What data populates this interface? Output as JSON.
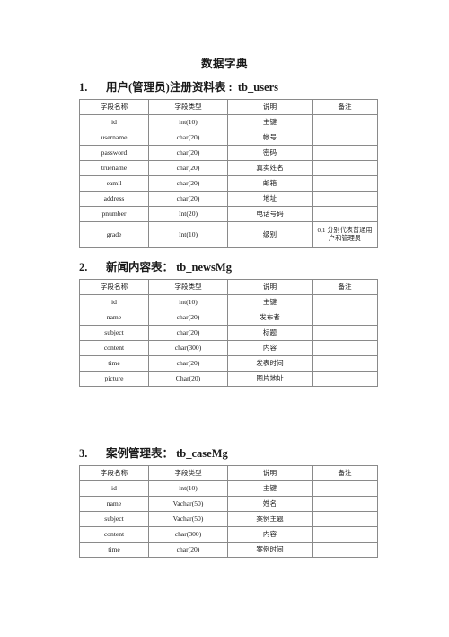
{
  "document": {
    "title": "数据字典",
    "column_headers": [
      "字段名称",
      "字段类型",
      "说明",
      "备注"
    ]
  },
  "sections": [
    {
      "number": "1.",
      "name": "用户(管理员)注册资料表 :",
      "table_name": "tb_users",
      "rows": [
        {
          "field": "id",
          "type": "int(10)",
          "desc": "主键",
          "remark": ""
        },
        {
          "field": "username",
          "type": "char(20)",
          "desc": "帐号",
          "remark": ""
        },
        {
          "field": "password",
          "type": "char(20)",
          "desc": "密码",
          "remark": ""
        },
        {
          "field": "truename",
          "type": "char(20)",
          "desc": "真实姓名",
          "remark": ""
        },
        {
          "field": "eamil",
          "type": "char(20)",
          "desc": "邮箱",
          "remark": ""
        },
        {
          "field": "address",
          "type": "char(20)",
          "desc": "地址",
          "remark": ""
        },
        {
          "field": "pnumber",
          "type": "Int(20)",
          "desc": "电话号码",
          "remark": ""
        },
        {
          "field": "grade",
          "type": "Int(10)",
          "desc": "级别",
          "remark": "0,1 分别代表普通用户和管理员"
        }
      ]
    },
    {
      "number": "2.",
      "name": "新闻内容表：",
      "table_name": "tb_newsMg",
      "rows": [
        {
          "field": "id",
          "type": "int(10)",
          "desc": "主键",
          "remark": ""
        },
        {
          "field": "name",
          "type": "char(20)",
          "desc": "发布者",
          "remark": ""
        },
        {
          "field": "subject",
          "type": "char(20)",
          "desc": "标题",
          "remark": ""
        },
        {
          "field": "content",
          "type": "char(300)",
          "desc": "内容",
          "remark": ""
        },
        {
          "field": "time",
          "type": "char(20)",
          "desc": "发表时间",
          "remark": ""
        },
        {
          "field": "picture",
          "type": "Char(20)",
          "desc": "图片地址",
          "remark": ""
        }
      ]
    },
    {
      "number": "3.",
      "name": "案例管理表：",
      "table_name": "tb_caseMg",
      "rows": [
        {
          "field": "id",
          "type": "int(10)",
          "desc": "主键",
          "remark": ""
        },
        {
          "field": "name",
          "type": "Vachar(50)",
          "desc": "姓名",
          "remark": ""
        },
        {
          "field": "subject",
          "type": "Vachar(50)",
          "desc": "案例主题",
          "remark": ""
        },
        {
          "field": "content",
          "type": "char(300)",
          "desc": "内容",
          "remark": ""
        },
        {
          "field": "time",
          "type": "char(20)",
          "desc": "案例时间",
          "remark": ""
        }
      ]
    }
  ]
}
